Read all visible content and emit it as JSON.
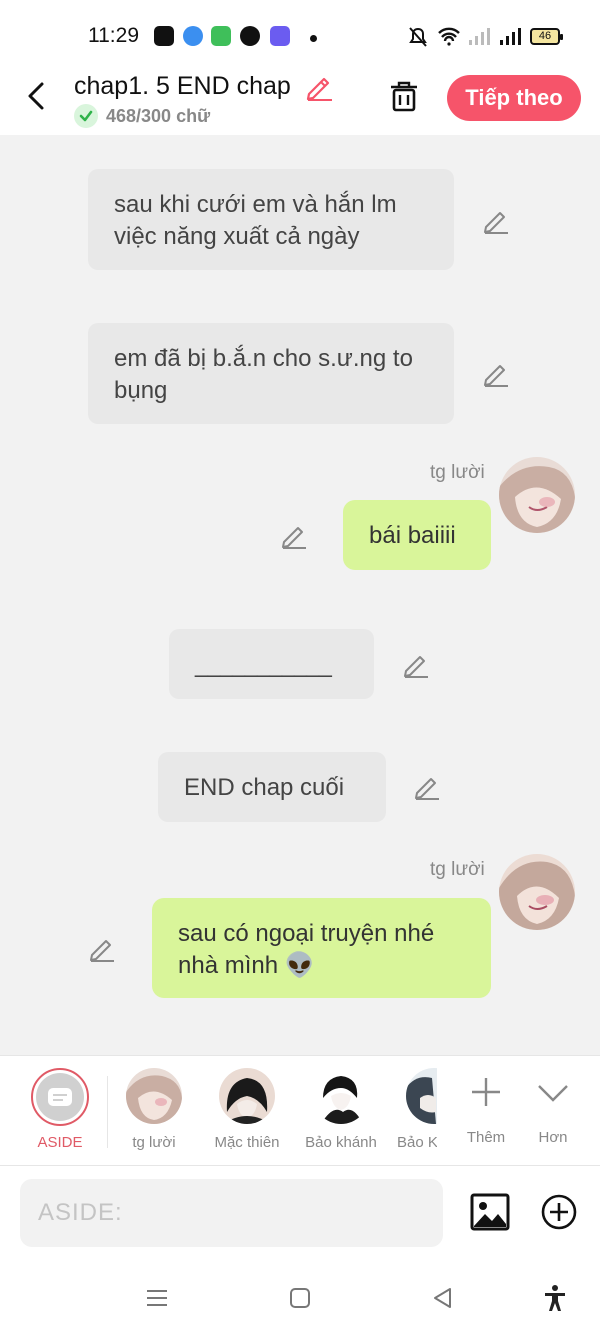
{
  "status_bar": {
    "time": "11:29",
    "battery": "46"
  },
  "header": {
    "title": "chap1. 5 END chap",
    "word_count": "468/300 chữ",
    "next_label": "Tiếp theo"
  },
  "messages": [
    {
      "type": "narration",
      "text": "sau khi cưới em và hắn lm việc năng xuất cả ngày"
    },
    {
      "type": "narration",
      "text": "em đã bị b.ắ.n  cho s.ư.ng to bụng"
    },
    {
      "type": "character",
      "name": "tg lười",
      "text": "bái baiiii"
    },
    {
      "type": "narration",
      "text": "___________"
    },
    {
      "type": "narration",
      "text": "END chap cuối"
    },
    {
      "type": "character",
      "name": "tg lười",
      "text": "sau có ngoại truyện nhé nhà mình 👽"
    }
  ],
  "characters": [
    {
      "label": "ASIDE",
      "active": true
    },
    {
      "label": "tg lười"
    },
    {
      "label": "Mặc thiên"
    },
    {
      "label": "Bảo khánh"
    },
    {
      "label": "Bảo K"
    }
  ],
  "actions": {
    "more_label": "Thêm",
    "less_label": "Hơn"
  },
  "input": {
    "placeholder": "ASIDE:"
  },
  "colors": {
    "accent": "#f6546a",
    "character_bubble": "#d9f59a",
    "narration_bubble": "#e8e8e8",
    "aside_ring": "#e05a66"
  }
}
